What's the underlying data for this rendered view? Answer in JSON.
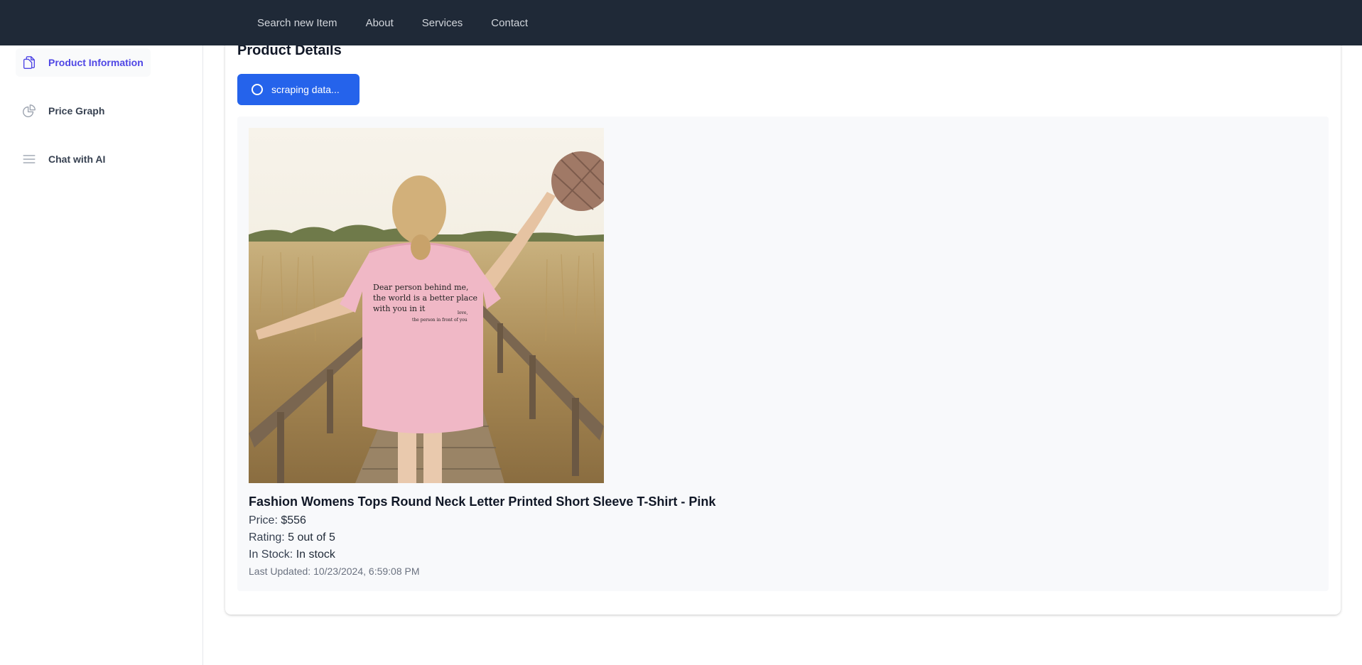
{
  "topnav": {
    "items": [
      {
        "label": "Search new Item"
      },
      {
        "label": "About"
      },
      {
        "label": "Services"
      },
      {
        "label": "Contact"
      }
    ]
  },
  "sidebar": {
    "items": [
      {
        "label": "Product Information",
        "icon": "document-duplicate-icon",
        "active": true
      },
      {
        "label": "Price Graph",
        "icon": "chart-pie-icon",
        "active": false
      },
      {
        "label": "Chat with AI",
        "icon": "bars-menu-icon",
        "active": false
      }
    ]
  },
  "main": {
    "title": "Product Details",
    "scrape_button_label": "scraping data...",
    "product": {
      "name": "Fashion Womens Tops Round Neck Letter Printed Short Sleeve T-Shirt - Pink",
      "price_label": "Price:",
      "price_value": "$556",
      "rating_label": "Rating:",
      "rating_value": "5 out of 5",
      "stock_label": "In Stock:",
      "stock_value": "In stock",
      "updated_label": "Last Updated:",
      "updated_value": "10/23/2024, 6:59:08 PM",
      "image": {
        "shirt_text_1": "Dear person behind me,",
        "shirt_text_2": "the world is a better place",
        "shirt_text_3": "with you in it",
        "shirt_text_4": "love,",
        "shirt_text_5": "the person in front of you"
      }
    }
  },
  "colors": {
    "topbar": "#1f2937",
    "accent": "#4f46e5",
    "button": "#2563eb",
    "panel": "#f8f9fb"
  }
}
